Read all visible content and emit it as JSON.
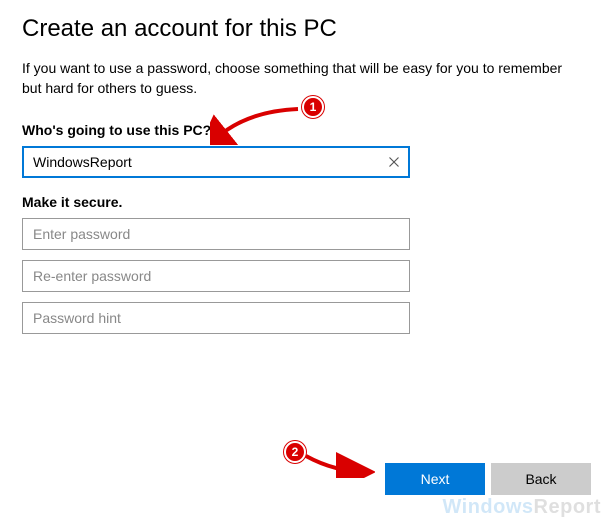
{
  "header": {
    "title": "Create an account for this PC",
    "description": "If you want to use a password, choose something that will be easy for you to remember but hard for others to guess."
  },
  "labels": {
    "who_label": "Who's going to use this PC?",
    "secure_label": "Make it secure."
  },
  "fields": {
    "username": {
      "value": "WindowsReport"
    },
    "password": {
      "placeholder": "Enter password"
    },
    "password_confirm": {
      "placeholder": "Re-enter password"
    },
    "password_hint": {
      "placeholder": "Password hint"
    }
  },
  "footer": {
    "next_label": "Next",
    "back_label": "Back"
  },
  "annotations": {
    "badge1": "1",
    "badge2": "2"
  },
  "watermark": {
    "part1": "Windows",
    "part2": "Report"
  }
}
